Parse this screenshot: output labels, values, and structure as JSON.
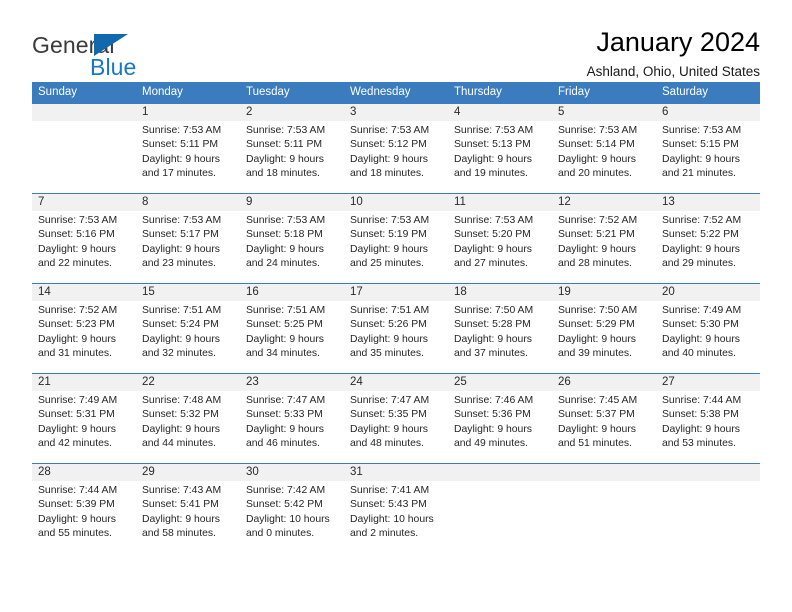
{
  "brand": {
    "name_part1": "General",
    "name_part2": "Blue",
    "accent_color": "#1878c8",
    "triangle_color": "#1168ad"
  },
  "header": {
    "title": "January 2024",
    "subtitle": "Ashland, Ohio, United States"
  },
  "calendar": {
    "header_bg": "#3a7cbe",
    "date_band_bg": "#f1f1f1",
    "weekdays": [
      "Sunday",
      "Monday",
      "Tuesday",
      "Wednesday",
      "Thursday",
      "Friday",
      "Saturday"
    ],
    "weeks": [
      {
        "days": [
          {
            "date": "",
            "lines": [
              "",
              "",
              "",
              ""
            ]
          },
          {
            "date": "1",
            "lines": [
              "Sunrise: 7:53 AM",
              "Sunset: 5:11 PM",
              "Daylight: 9 hours",
              "and 17 minutes."
            ]
          },
          {
            "date": "2",
            "lines": [
              "Sunrise: 7:53 AM",
              "Sunset: 5:11 PM",
              "Daylight: 9 hours",
              "and 18 minutes."
            ]
          },
          {
            "date": "3",
            "lines": [
              "Sunrise: 7:53 AM",
              "Sunset: 5:12 PM",
              "Daylight: 9 hours",
              "and 18 minutes."
            ]
          },
          {
            "date": "4",
            "lines": [
              "Sunrise: 7:53 AM",
              "Sunset: 5:13 PM",
              "Daylight: 9 hours",
              "and 19 minutes."
            ]
          },
          {
            "date": "5",
            "lines": [
              "Sunrise: 7:53 AM",
              "Sunset: 5:14 PM",
              "Daylight: 9 hours",
              "and 20 minutes."
            ]
          },
          {
            "date": "6",
            "lines": [
              "Sunrise: 7:53 AM",
              "Sunset: 5:15 PM",
              "Daylight: 9 hours",
              "and 21 minutes."
            ]
          }
        ]
      },
      {
        "days": [
          {
            "date": "7",
            "lines": [
              "Sunrise: 7:53 AM",
              "Sunset: 5:16 PM",
              "Daylight: 9 hours",
              "and 22 minutes."
            ]
          },
          {
            "date": "8",
            "lines": [
              "Sunrise: 7:53 AM",
              "Sunset: 5:17 PM",
              "Daylight: 9 hours",
              "and 23 minutes."
            ]
          },
          {
            "date": "9",
            "lines": [
              "Sunrise: 7:53 AM",
              "Sunset: 5:18 PM",
              "Daylight: 9 hours",
              "and 24 minutes."
            ]
          },
          {
            "date": "10",
            "lines": [
              "Sunrise: 7:53 AM",
              "Sunset: 5:19 PM",
              "Daylight: 9 hours",
              "and 25 minutes."
            ]
          },
          {
            "date": "11",
            "lines": [
              "Sunrise: 7:53 AM",
              "Sunset: 5:20 PM",
              "Daylight: 9 hours",
              "and 27 minutes."
            ]
          },
          {
            "date": "12",
            "lines": [
              "Sunrise: 7:52 AM",
              "Sunset: 5:21 PM",
              "Daylight: 9 hours",
              "and 28 minutes."
            ]
          },
          {
            "date": "13",
            "lines": [
              "Sunrise: 7:52 AM",
              "Sunset: 5:22 PM",
              "Daylight: 9 hours",
              "and 29 minutes."
            ]
          }
        ]
      },
      {
        "days": [
          {
            "date": "14",
            "lines": [
              "Sunrise: 7:52 AM",
              "Sunset: 5:23 PM",
              "Daylight: 9 hours",
              "and 31 minutes."
            ]
          },
          {
            "date": "15",
            "lines": [
              "Sunrise: 7:51 AM",
              "Sunset: 5:24 PM",
              "Daylight: 9 hours",
              "and 32 minutes."
            ]
          },
          {
            "date": "16",
            "lines": [
              "Sunrise: 7:51 AM",
              "Sunset: 5:25 PM",
              "Daylight: 9 hours",
              "and 34 minutes."
            ]
          },
          {
            "date": "17",
            "lines": [
              "Sunrise: 7:51 AM",
              "Sunset: 5:26 PM",
              "Daylight: 9 hours",
              "and 35 minutes."
            ]
          },
          {
            "date": "18",
            "lines": [
              "Sunrise: 7:50 AM",
              "Sunset: 5:28 PM",
              "Daylight: 9 hours",
              "and 37 minutes."
            ]
          },
          {
            "date": "19",
            "lines": [
              "Sunrise: 7:50 AM",
              "Sunset: 5:29 PM",
              "Daylight: 9 hours",
              "and 39 minutes."
            ]
          },
          {
            "date": "20",
            "lines": [
              "Sunrise: 7:49 AM",
              "Sunset: 5:30 PM",
              "Daylight: 9 hours",
              "and 40 minutes."
            ]
          }
        ]
      },
      {
        "days": [
          {
            "date": "21",
            "lines": [
              "Sunrise: 7:49 AM",
              "Sunset: 5:31 PM",
              "Daylight: 9 hours",
              "and 42 minutes."
            ]
          },
          {
            "date": "22",
            "lines": [
              "Sunrise: 7:48 AM",
              "Sunset: 5:32 PM",
              "Daylight: 9 hours",
              "and 44 minutes."
            ]
          },
          {
            "date": "23",
            "lines": [
              "Sunrise: 7:47 AM",
              "Sunset: 5:33 PM",
              "Daylight: 9 hours",
              "and 46 minutes."
            ]
          },
          {
            "date": "24",
            "lines": [
              "Sunrise: 7:47 AM",
              "Sunset: 5:35 PM",
              "Daylight: 9 hours",
              "and 48 minutes."
            ]
          },
          {
            "date": "25",
            "lines": [
              "Sunrise: 7:46 AM",
              "Sunset: 5:36 PM",
              "Daylight: 9 hours",
              "and 49 minutes."
            ]
          },
          {
            "date": "26",
            "lines": [
              "Sunrise: 7:45 AM",
              "Sunset: 5:37 PM",
              "Daylight: 9 hours",
              "and 51 minutes."
            ]
          },
          {
            "date": "27",
            "lines": [
              "Sunrise: 7:44 AM",
              "Sunset: 5:38 PM",
              "Daylight: 9 hours",
              "and 53 minutes."
            ]
          }
        ]
      },
      {
        "days": [
          {
            "date": "28",
            "lines": [
              "Sunrise: 7:44 AM",
              "Sunset: 5:39 PM",
              "Daylight: 9 hours",
              "and 55 minutes."
            ]
          },
          {
            "date": "29",
            "lines": [
              "Sunrise: 7:43 AM",
              "Sunset: 5:41 PM",
              "Daylight: 9 hours",
              "and 58 minutes."
            ]
          },
          {
            "date": "30",
            "lines": [
              "Sunrise: 7:42 AM",
              "Sunset: 5:42 PM",
              "Daylight: 10 hours",
              "and 0 minutes."
            ]
          },
          {
            "date": "31",
            "lines": [
              "Sunrise: 7:41 AM",
              "Sunset: 5:43 PM",
              "Daylight: 10 hours",
              "and 2 minutes."
            ]
          },
          {
            "date": "",
            "lines": [
              "",
              "",
              "",
              ""
            ]
          },
          {
            "date": "",
            "lines": [
              "",
              "",
              "",
              ""
            ]
          },
          {
            "date": "",
            "lines": [
              "",
              "",
              "",
              ""
            ]
          }
        ]
      }
    ]
  }
}
